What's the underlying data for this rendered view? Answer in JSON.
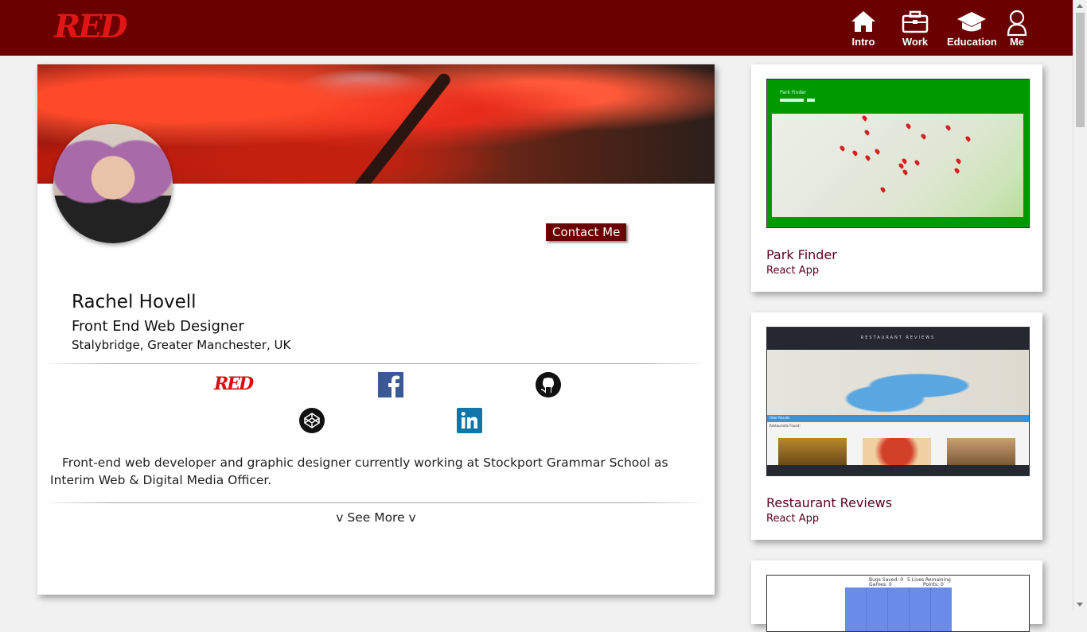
{
  "nav": {
    "logo_text": "RED",
    "items": [
      {
        "label": "Intro",
        "icon": "home-icon"
      },
      {
        "label": "Work",
        "icon": "briefcase-icon"
      },
      {
        "label": "Education",
        "icon": "graduation-cap-icon"
      },
      {
        "label": "Me",
        "icon": "user-icon"
      }
    ]
  },
  "profile": {
    "contact_label": "Contact Me",
    "name": "Rachel Hovell",
    "role": "Front End Web Designer",
    "location": "Stalybridge, Greater Manchester, UK",
    "social": [
      {
        "name": "red-logo",
        "text": "RED"
      },
      {
        "name": "facebook-icon",
        "text": "f"
      },
      {
        "name": "github-icon"
      },
      {
        "name": "codepen-icon"
      },
      {
        "name": "linkedin-icon",
        "text": "in"
      }
    ],
    "bio": "Front-end web developer and graphic designer currently working at Stockport Grammar School as Interim Web & Digital Media Officer.",
    "see_more": "v See More v"
  },
  "projects": [
    {
      "title": "Park Finder",
      "subtitle": "React App",
      "screenshot_heading": "Park Finder",
      "accent": "#009a00"
    },
    {
      "title": "Restaurant Reviews",
      "subtitle": "React App",
      "screenshot_heading": "RESTAURANT REVIEWS",
      "filter_label": "Filter Results",
      "found_label": "Restaurants Found:",
      "accent": "#252831"
    },
    {
      "title": "",
      "subtitle": "",
      "stats_left": "Bugs Saved: 0",
      "stats_left2": "Games: 0",
      "stats_right": "5 Lives Remaining",
      "stats_right2": "Points: 0"
    }
  ],
  "colors": {
    "brand": "#6b0000",
    "accent_red": "#e01616",
    "title": "#5a0020"
  }
}
